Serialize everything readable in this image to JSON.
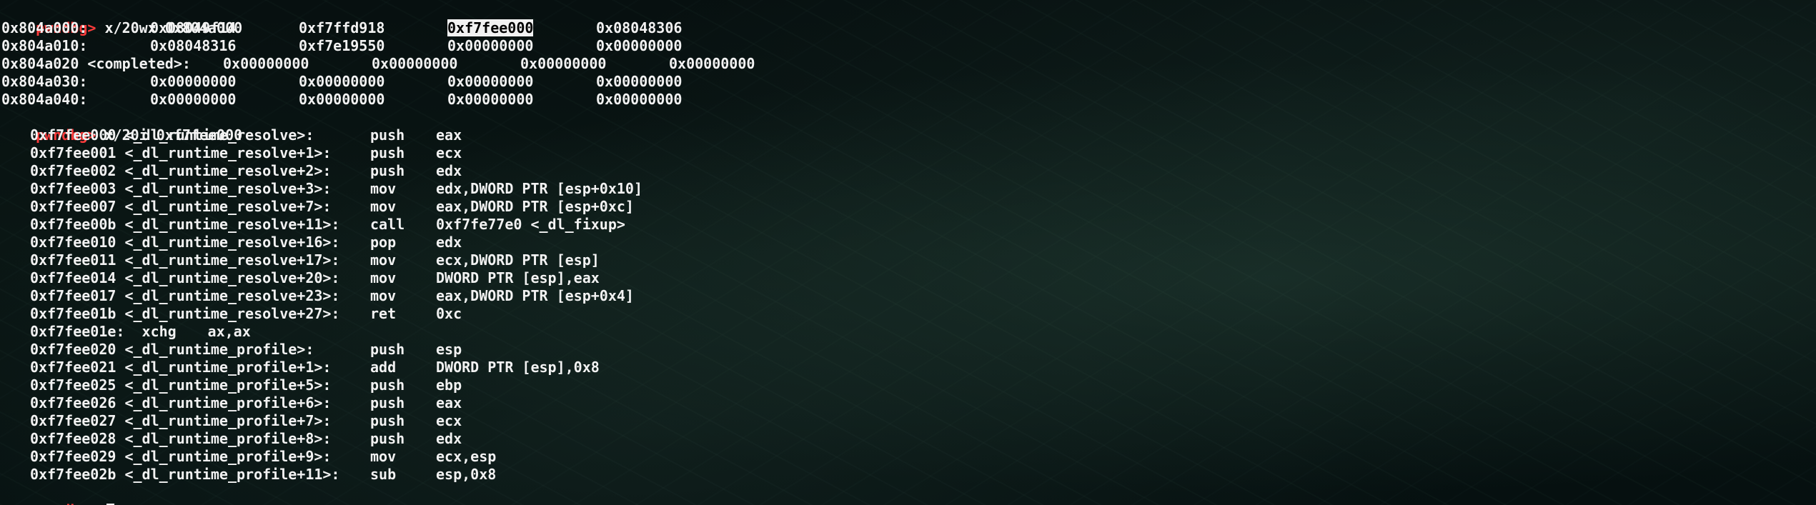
{
  "prompt": "pwndbg>",
  "commands": [
    "x/20wx 0x804a000",
    "x/20i 0xf7fee000"
  ],
  "memory_dump": [
    {
      "addr": "0x804a000:",
      "values": [
        "0x08049f14",
        "0xf7ffd918",
        "0xf7fee000",
        "0x08048306"
      ],
      "highlight_index": 2
    },
    {
      "addr": "0x804a010:",
      "values": [
        "0x08048316",
        "0xf7e19550",
        "0x00000000",
        "0x00000000"
      ]
    },
    {
      "addr": "0x804a020 <completed>:",
      "values": [
        "0x00000000",
        "0x00000000",
        "0x00000000",
        "0x00000000"
      ]
    },
    {
      "addr": "0x804a030:",
      "values": [
        "0x00000000",
        "0x00000000",
        "0x00000000",
        "0x00000000"
      ]
    },
    {
      "addr": "0x804a040:",
      "values": [
        "0x00000000",
        "0x00000000",
        "0x00000000",
        "0x00000000"
      ]
    }
  ],
  "disassembly": [
    {
      "loc": "0xf7fee000 <_dl_runtime_resolve>:",
      "op": "push",
      "args": "eax"
    },
    {
      "loc": "0xf7fee001 <_dl_runtime_resolve+1>:",
      "op": "push",
      "args": "ecx"
    },
    {
      "loc": "0xf7fee002 <_dl_runtime_resolve+2>:",
      "op": "push",
      "args": "edx"
    },
    {
      "loc": "0xf7fee003 <_dl_runtime_resolve+3>:",
      "op": "mov",
      "args": "edx,DWORD PTR [esp+0x10]"
    },
    {
      "loc": "0xf7fee007 <_dl_runtime_resolve+7>:",
      "op": "mov",
      "args": "eax,DWORD PTR [esp+0xc]"
    },
    {
      "loc": "0xf7fee00b <_dl_runtime_resolve+11>:",
      "op": "call",
      "args": "0xf7fe77e0 <_dl_fixup>"
    },
    {
      "loc": "0xf7fee010 <_dl_runtime_resolve+16>:",
      "op": "pop",
      "args": "edx"
    },
    {
      "loc": "0xf7fee011 <_dl_runtime_resolve+17>:",
      "op": "mov",
      "args": "ecx,DWORD PTR [esp]"
    },
    {
      "loc": "0xf7fee014 <_dl_runtime_resolve+20>:",
      "op": "mov",
      "args": "DWORD PTR [esp],eax"
    },
    {
      "loc": "0xf7fee017 <_dl_runtime_resolve+23>:",
      "op": "mov",
      "args": "eax,DWORD PTR [esp+0x4]"
    },
    {
      "loc": "0xf7fee01b <_dl_runtime_resolve+27>:",
      "op": "ret",
      "args": "0xc"
    },
    {
      "loc": "0xf7fee01e:",
      "op": "xchg",
      "args": "ax,ax",
      "compact": true
    },
    {
      "loc": "0xf7fee020 <_dl_runtime_profile>:",
      "op": "push",
      "args": "esp"
    },
    {
      "loc": "0xf7fee021 <_dl_runtime_profile+1>:",
      "op": "add",
      "args": "DWORD PTR [esp],0x8"
    },
    {
      "loc": "0xf7fee025 <_dl_runtime_profile+5>:",
      "op": "push",
      "args": "ebp"
    },
    {
      "loc": "0xf7fee026 <_dl_runtime_profile+6>:",
      "op": "push",
      "args": "eax"
    },
    {
      "loc": "0xf7fee027 <_dl_runtime_profile+7>:",
      "op": "push",
      "args": "ecx"
    },
    {
      "loc": "0xf7fee028 <_dl_runtime_profile+8>:",
      "op": "push",
      "args": "edx"
    },
    {
      "loc": "0xf7fee029 <_dl_runtime_profile+9>:",
      "op": "mov",
      "args": "ecx,esp"
    },
    {
      "loc": "0xf7fee02b <_dl_runtime_profile+11>:",
      "op": "sub",
      "args": "esp,0x8"
    }
  ],
  "colors": {
    "prompt": "#ff3b3b",
    "text": "#f2f2f2",
    "background": "#050a09"
  }
}
